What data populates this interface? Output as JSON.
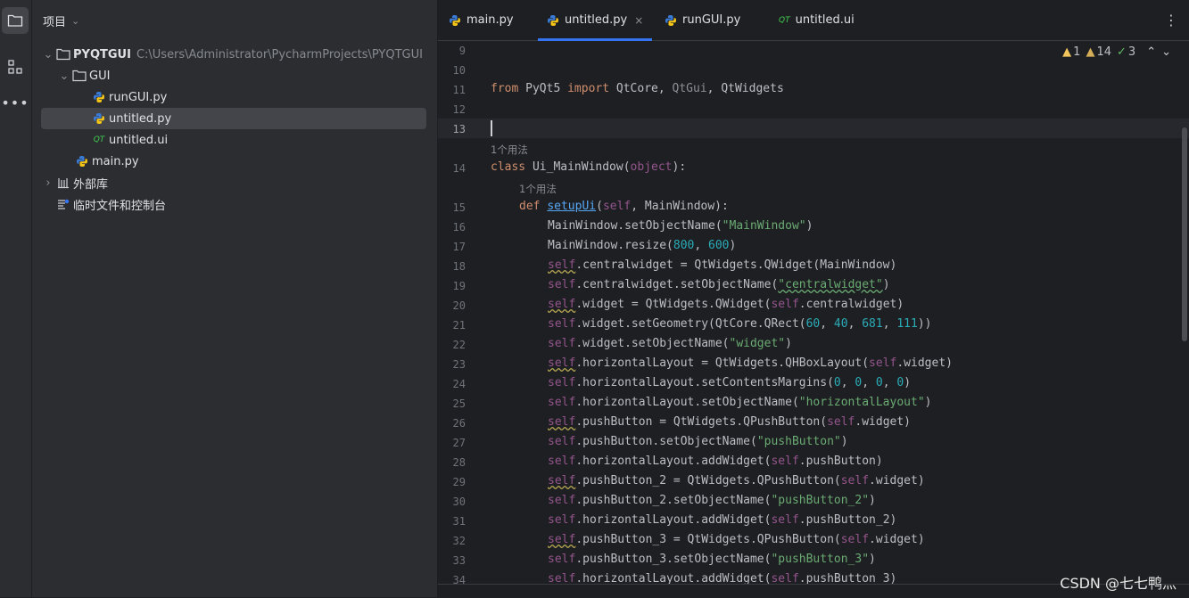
{
  "project_panel": {
    "title": "项目",
    "tree": [
      {
        "label": "PYQTGUI",
        "path": "C:\\Users\\Administrator\\PycharmProjects\\PYQTGUI"
      },
      {
        "label": "GUI"
      },
      {
        "label": "runGUI.py"
      },
      {
        "label": "untitled.py"
      },
      {
        "label": "untitled.ui"
      },
      {
        "label": "main.py"
      },
      {
        "label": "外部库"
      },
      {
        "label": "临时文件和控制台"
      }
    ]
  },
  "tabs": [
    {
      "label": "main.py"
    },
    {
      "label": "untitled.py",
      "close": "×"
    },
    {
      "label": "runGUI.py"
    },
    {
      "label": "untitled.ui"
    }
  ],
  "inspections": {
    "errors": "1",
    "warnings": "14",
    "ok": "3"
  },
  "usage_hints": [
    "1个用法",
    "1个用法"
  ],
  "line_numbers": [
    "9",
    "10",
    "11",
    "12",
    "13",
    "14",
    "15",
    "16",
    "17",
    "18",
    "19",
    "20",
    "21",
    "22",
    "23",
    "24",
    "25",
    "26",
    "27",
    "28",
    "29",
    "30",
    "31",
    "32",
    "33",
    "34"
  ],
  "code": {
    "l11": {
      "a": "from",
      "b": " PyQt5 ",
      "c": "import",
      "d": " QtCore, ",
      "e": "QtGui",
      "f": ", QtWidgets"
    },
    "l14": {
      "a": "class",
      "b": " Ui_MainWindow",
      "c": "(",
      "d": "object",
      "e": "):"
    },
    "l15": {
      "a": "def",
      "b": "setupUi",
      "c": "(",
      "d": "self",
      "e": ", MainWindow):"
    },
    "l16": {
      "a": "MainWindow.setObjectName(",
      "b": "\"MainWindow\"",
      "c": ")"
    },
    "l17": {
      "a": "MainWindow.resize(",
      "b": "800",
      "c": ", ",
      "d": "600",
      "e": ")"
    },
    "l18": {
      "a": "self",
      "b": ".centralwidget = QtWidgets.QWidget(MainWindow)"
    },
    "l19": {
      "a": "self",
      "b": ".centralwidget.setObjectName(",
      "c": "\"centralwidget\"",
      "d": ")"
    },
    "l20": {
      "a": "self",
      "b": ".widget = QtWidgets.QWidget(",
      "c": "self",
      "d": ".centralwidget)"
    },
    "l21": {
      "a": "self",
      "b": ".widget.setGeometry(QtCore.QRect(",
      "c": "60",
      "d": ", ",
      "e": "40",
      "f": ", ",
      "g": "681",
      "h": ", ",
      "i": "111",
      "j": "))"
    },
    "l22": {
      "a": "self",
      "b": ".widget.setObjectName(",
      "c": "\"widget\"",
      "d": ")"
    },
    "l23": {
      "a": "self",
      "b": ".horizontalLayout = QtWidgets.QHBoxLayout(",
      "c": "self",
      "d": ".widget)"
    },
    "l24": {
      "a": "self",
      "b": ".horizontalLayout.setContentsMargins(",
      "c": "0",
      "d": ", ",
      "e": "0",
      "f": ", ",
      "g": "0",
      "h": ", ",
      "i": "0",
      "j": ")"
    },
    "l25": {
      "a": "self",
      "b": ".horizontalLayout.setObjectName(",
      "c": "\"horizontalLayout\"",
      "d": ")"
    },
    "l26": {
      "a": "self",
      "b": ".pushButton = QtWidgets.QPushButton(",
      "c": "self",
      "d": ".widget)"
    },
    "l27": {
      "a": "self",
      "b": ".pushButton.setObjectName(",
      "c": "\"pushButton\"",
      "d": ")"
    },
    "l28": {
      "a": "self",
      "b": ".horizontalLayout.addWidget(",
      "c": "self",
      "d": ".pushButton)"
    },
    "l29": {
      "a": "self",
      "b": ".pushButton_2 = QtWidgets.QPushButton(",
      "c": "self",
      "d": ".widget)"
    },
    "l30": {
      "a": "self",
      "b": ".pushButton_2.setObjectName(",
      "c": "\"pushButton_2\"",
      "d": ")"
    },
    "l31": {
      "a": "self",
      "b": ".horizontalLayout.addWidget(",
      "c": "self",
      "d": ".pushButton_2)"
    },
    "l32": {
      "a": "self",
      "b": ".pushButton_3 = QtWidgets.QPushButton(",
      "c": "self",
      "d": ".widget)"
    },
    "l33": {
      "a": "self",
      "b": ".pushButton_3.setObjectName(",
      "c": "\"pushButton_3\"",
      "d": ")"
    },
    "l34": {
      "a": "self",
      "b": ".horizontalLayout.addWidget(",
      "c": "self",
      "d": ".pushButton_3)"
    }
  },
  "watermark": "CSDN @七七鸭灬",
  "colors": {
    "accent": "#3574f0",
    "keyword": "#cf8e6d",
    "self": "#94558d",
    "string": "#6aab73",
    "number": "#2aacb8",
    "function": "#56a8f5"
  }
}
